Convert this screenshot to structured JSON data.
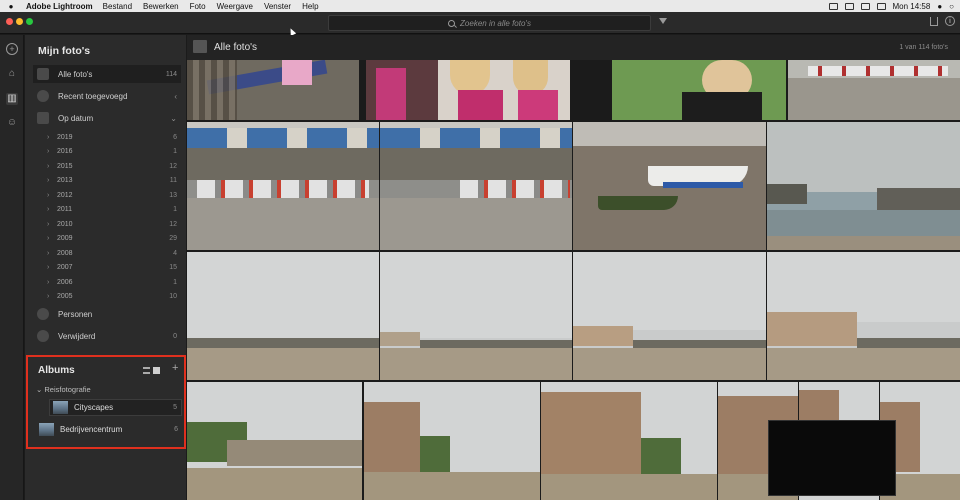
{
  "menubar": {
    "app_name": "Adobe Lightroom",
    "items": [
      "Bestand",
      "Bewerken",
      "Foto",
      "Weergave",
      "Venster",
      "Help"
    ],
    "clock": "Mon 14:58"
  },
  "search": {
    "placeholder": "Zoeken in alle foto's"
  },
  "sidebar": {
    "title": "Mijn foto's",
    "all_photos": {
      "label": "Alle foto's",
      "count": "114"
    },
    "recent": {
      "label": "Recent toegevoegd"
    },
    "by_date": {
      "label": "Op datum"
    },
    "years": [
      {
        "label": "2019",
        "count": "6"
      },
      {
        "label": "2016",
        "count": "1"
      },
      {
        "label": "2015",
        "count": "12"
      },
      {
        "label": "2013",
        "count": "11"
      },
      {
        "label": "2012",
        "count": "13"
      },
      {
        "label": "2011",
        "count": "1"
      },
      {
        "label": "2010",
        "count": "12"
      },
      {
        "label": "2009",
        "count": "29"
      },
      {
        "label": "2008",
        "count": "4"
      },
      {
        "label": "2007",
        "count": "15"
      },
      {
        "label": "2006",
        "count": "1"
      },
      {
        "label": "2005",
        "count": "10"
      }
    ],
    "people": {
      "label": "Personen"
    },
    "deleted": {
      "label": "Verwijderd",
      "count": "0"
    }
  },
  "albums": {
    "title": "Albums",
    "folder": "Reisfotografie",
    "items": [
      {
        "label": "Cityscapes",
        "count": "5"
      },
      {
        "label": "Bedrijvencentrum",
        "count": "6"
      }
    ]
  },
  "main": {
    "title": "Alle foto's",
    "count_text": "1 van 114 foto's"
  },
  "icons": {
    "rail": [
      "add-icon",
      "home-icon",
      "library-icon",
      "people-icon"
    ],
    "accent_highlight": "#e0301e"
  }
}
